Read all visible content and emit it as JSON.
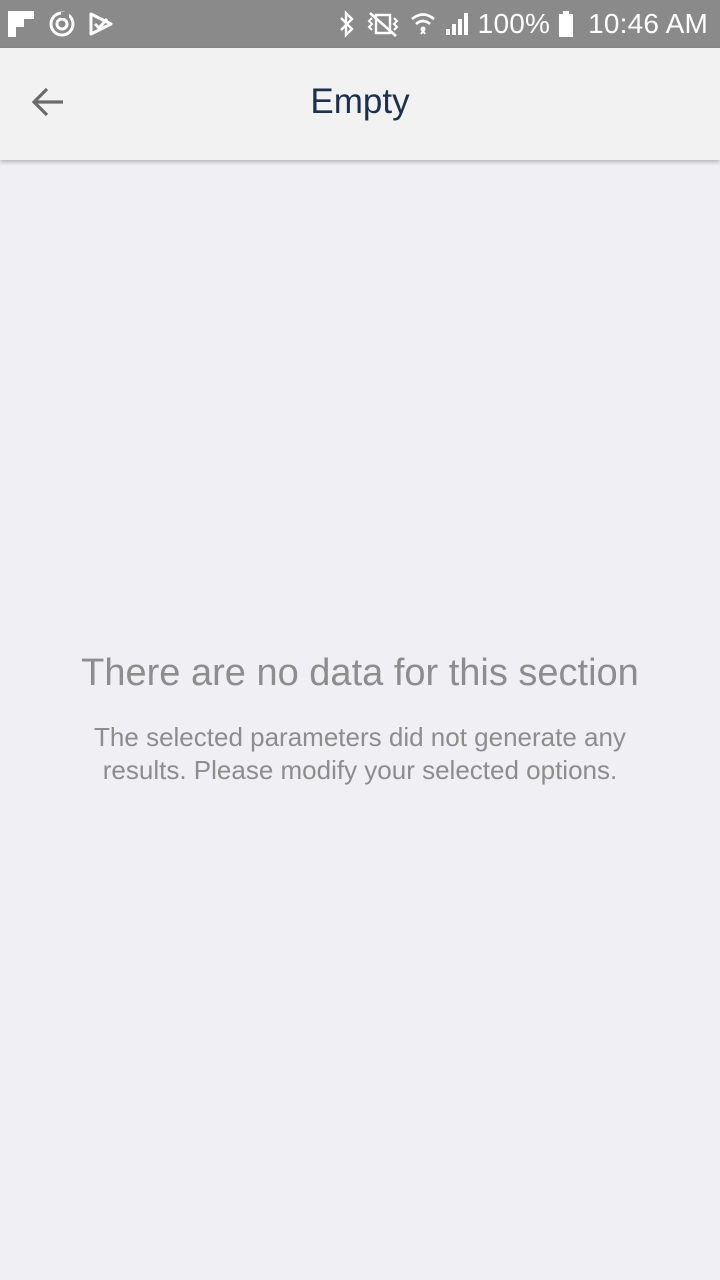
{
  "status_bar": {
    "left_icons": [
      "flipboard-icon",
      "sync-icon",
      "checkmark-notification-icon"
    ],
    "right_icons": [
      "bluetooth-icon",
      "vibrate-mute-icon",
      "wifi-icon",
      "signal-icon",
      "battery-icon"
    ],
    "battery": "100%",
    "time": "10:46 AM"
  },
  "app_bar": {
    "title": "Empty",
    "back_icon": "arrow-back-icon"
  },
  "empty_state": {
    "title": "There are no data for this section",
    "message": "The selected parameters did not generate any results. Please modify your selected options."
  },
  "colors": {
    "status_bar_bg": "#8a8a8a",
    "app_bar_bg": "#f2f2f2",
    "title_color": "#1b3050",
    "content_bg": "#f0f0f4",
    "muted_text": "#8d8d8d"
  }
}
